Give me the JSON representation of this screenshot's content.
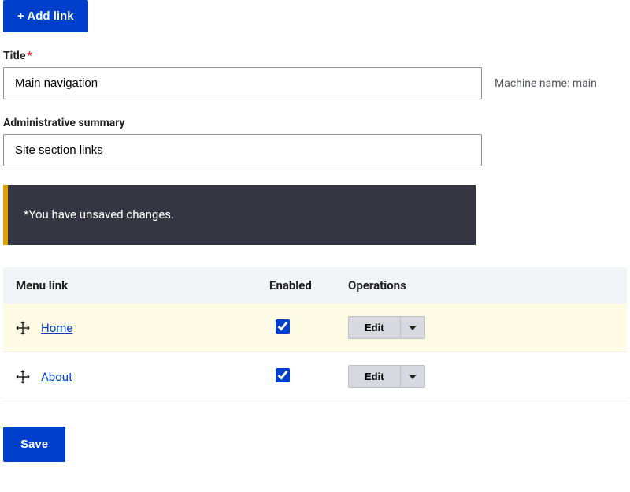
{
  "buttons": {
    "add_link": "+ Add link",
    "save": "Save"
  },
  "fields": {
    "title_label": "Title",
    "title_value": "Main navigation",
    "machine_name_label": "Machine name:",
    "machine_name_value": "main",
    "summary_label": "Administrative summary",
    "summary_value": "Site section links"
  },
  "alert": {
    "message": "*You have unsaved changes."
  },
  "table": {
    "headers": {
      "menu_link": "Menu link",
      "enabled": "Enabled",
      "operations": "Operations"
    },
    "rows": [
      {
        "label": "Home",
        "enabled": true,
        "op": "Edit"
      },
      {
        "label": "About",
        "enabled": true,
        "op": "Edit"
      }
    ]
  }
}
